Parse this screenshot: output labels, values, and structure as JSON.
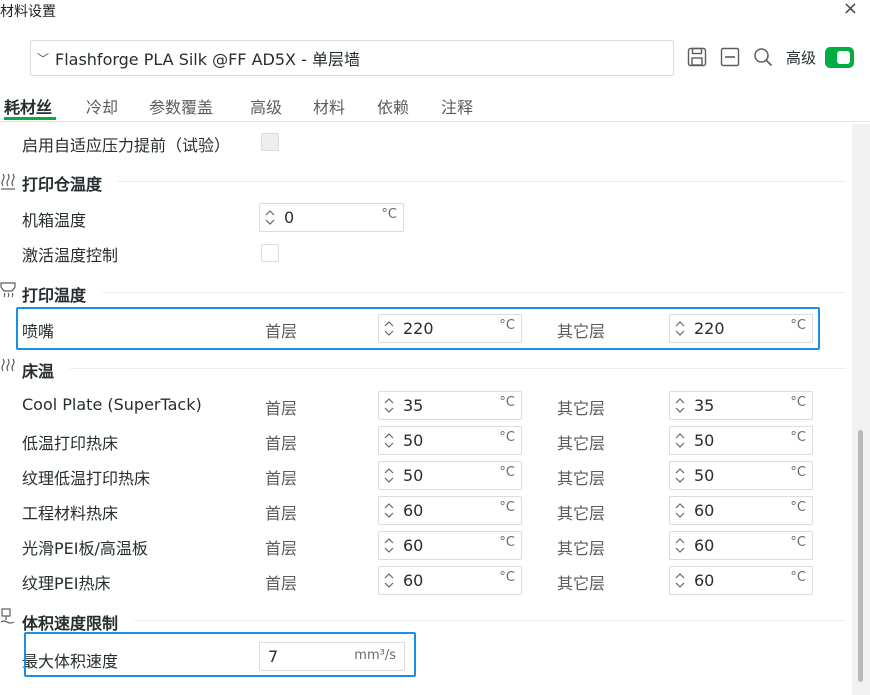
{
  "window": {
    "title": "材料设置",
    "close_icon": "×"
  },
  "preset": {
    "chevron": "﹀",
    "name": "Flashforge PLA Silk @FF AD5X - 单层墙"
  },
  "toolbar": {
    "save_icon": "save-icon",
    "minimize_icon": "minus-square-icon",
    "search_icon": "search-icon",
    "advanced_label": "高级",
    "advanced_toggle_on": true
  },
  "tabs": [
    {
      "label": "耗材丝",
      "active": true
    },
    {
      "label": "冷却",
      "active": false
    },
    {
      "label": "参数覆盖",
      "active": false
    },
    {
      "label": "高级",
      "active": false
    },
    {
      "label": "材料",
      "active": false
    },
    {
      "label": "依赖",
      "active": false
    },
    {
      "label": "注释",
      "active": false
    }
  ],
  "adaptive_pa": {
    "label": "启用自适应压力提前（试验）",
    "checked": false,
    "disabled": true
  },
  "chamber": {
    "title": "打印仓温度",
    "rows": [
      {
        "label": "机箱温度",
        "value": "0",
        "unit": "°C"
      },
      {
        "label": "激活温度控制",
        "checked": false
      }
    ]
  },
  "print_temp": {
    "title": "打印温度",
    "nozzle": {
      "label": "喷嘴",
      "first_label": "首层",
      "first_value": "220",
      "first_unit": "°C",
      "other_label": "其它层",
      "other_value": "220",
      "other_unit": "°C"
    }
  },
  "bed_temp": {
    "title": "床温",
    "first_label": "首层",
    "other_label": "其它层",
    "unit": "°C",
    "plates": [
      {
        "label": "Cool Plate (SuperTack)",
        "first": "35",
        "other": "35"
      },
      {
        "label": "低温打印热床",
        "first": "50",
        "other": "50"
      },
      {
        "label": "纹理低温打印热床",
        "first": "50",
        "other": "50"
      },
      {
        "label": "工程材料热床",
        "first": "60",
        "other": "60"
      },
      {
        "label": "光滑PEI板/高温板",
        "first": "60",
        "other": "60"
      },
      {
        "label": "纹理PEI热床",
        "first": "60",
        "other": "60"
      }
    ]
  },
  "volumetric": {
    "title": "体积速度限制",
    "max_label": "最大体积速度",
    "max_value": "7",
    "max_unit": "mm³/s"
  },
  "colors": {
    "accent": "#00ae42",
    "highlight": "#1a8fe3",
    "border": "#dcdcdc"
  }
}
